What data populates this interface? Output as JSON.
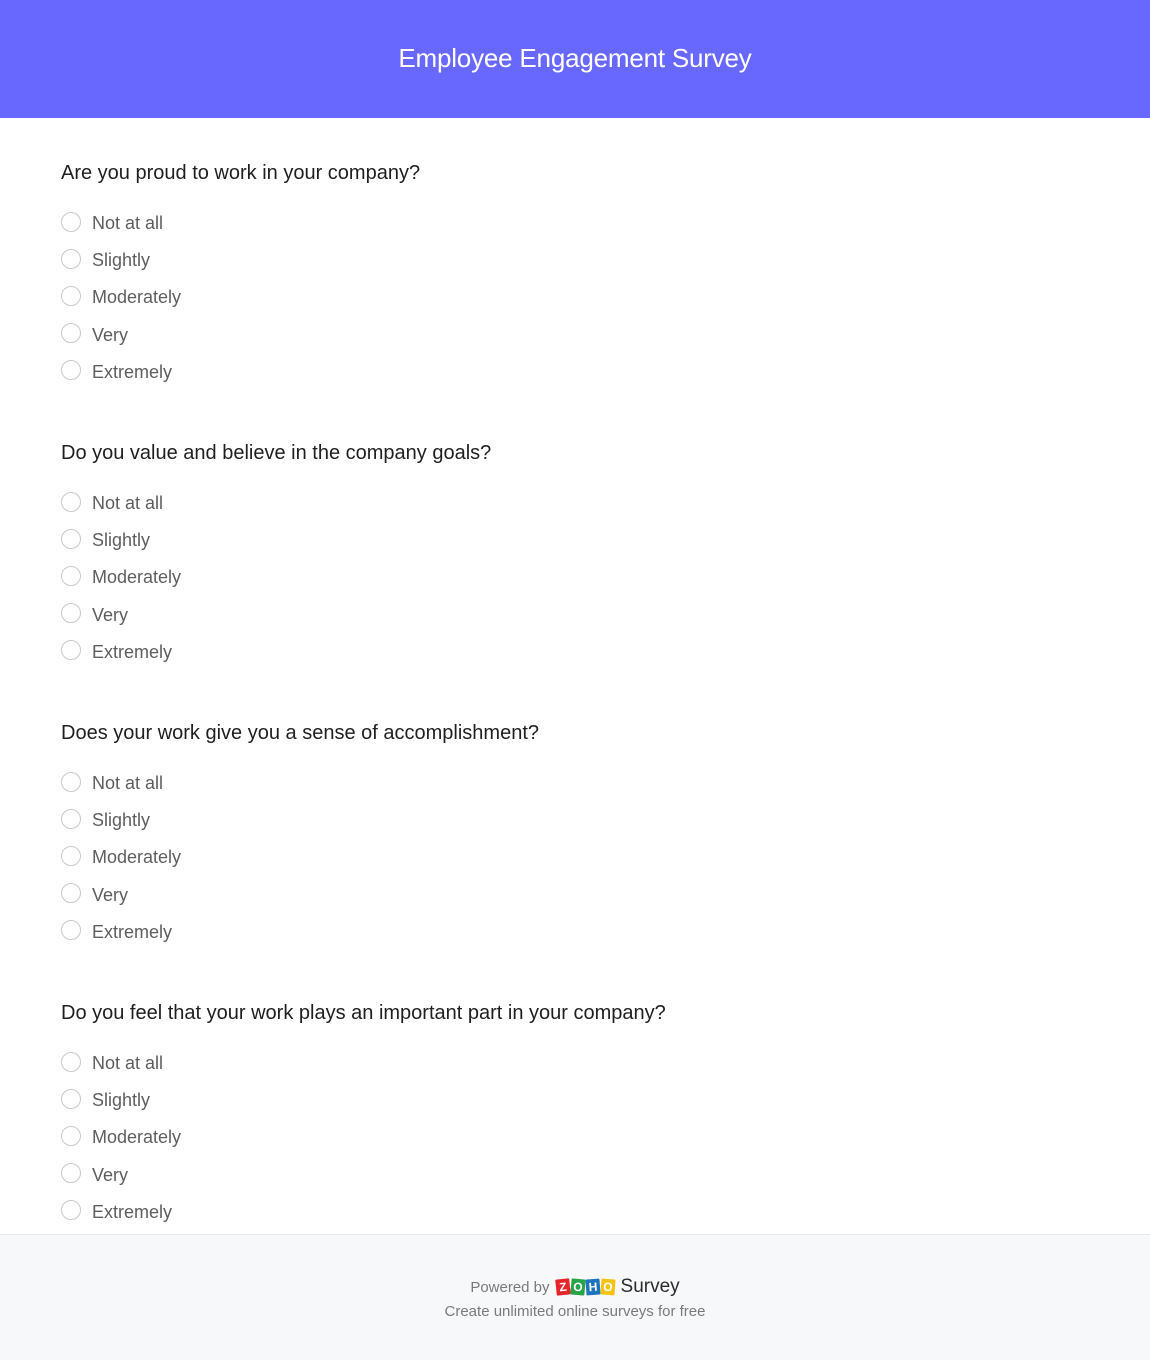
{
  "header": {
    "title": "Employee Engagement Survey",
    "color": "#6868ff"
  },
  "questions": [
    {
      "title": "Are you proud to work in your company?",
      "options": [
        "Not at all",
        "Slightly",
        "Moderately",
        "Very",
        "Extremely"
      ]
    },
    {
      "title": "Do you value and believe in the company goals?",
      "options": [
        "Not at all",
        "Slightly",
        "Moderately",
        "Very",
        "Extremely"
      ]
    },
    {
      "title": "Does your work give you a sense of accomplishment?",
      "options": [
        "Not at all",
        "Slightly",
        "Moderately",
        "Very",
        "Extremely"
      ]
    },
    {
      "title": "Do you feel that your work plays an important part in your company?",
      "options": [
        "Not at all",
        "Slightly",
        "Moderately",
        "Very",
        "Extremely"
      ]
    }
  ],
  "footer": {
    "powered_by": "Powered by",
    "logo_letters": [
      "Z",
      "O",
      "H",
      "O"
    ],
    "brand": "Survey",
    "tagline": "Create unlimited online surveys for free"
  }
}
